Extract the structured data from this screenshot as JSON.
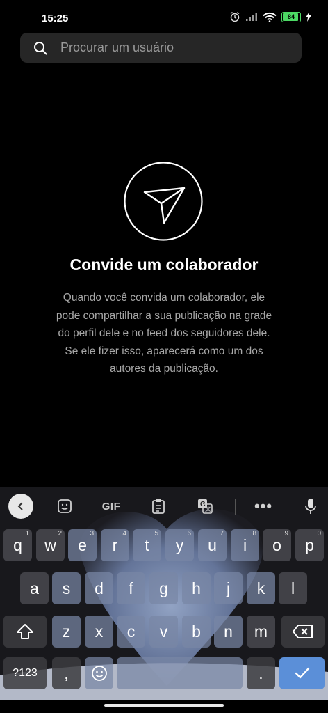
{
  "status_bar": {
    "time": "15:25",
    "battery_level": "84",
    "icons": [
      "alarm-icon",
      "signal-icon",
      "wifi-icon",
      "battery-icon",
      "charging-icon"
    ]
  },
  "search": {
    "placeholder": "Procurar um usuário",
    "icon": "search-icon"
  },
  "empty_state": {
    "icon": "send-icon",
    "title": "Convide um colaborador",
    "description": "Quando você convida um colaborador, ele pode compartilhar a sua publicação na grade do perfil dele e no feed dos seguidores dele. Se ele fizer isso, aparecerá como um dos autores da publicação."
  },
  "keyboard": {
    "toolbar": {
      "items": [
        "back-icon",
        "sticker-icon",
        "gif-button",
        "clipboard-icon",
        "translate-icon",
        "more-icon",
        "mic-icon"
      ],
      "gif_label": "GIF",
      "more_label": "•••"
    },
    "row1": [
      {
        "key": "q",
        "hint": "1"
      },
      {
        "key": "w",
        "hint": "2"
      },
      {
        "key": "e",
        "hint": "3"
      },
      {
        "key": "r",
        "hint": "4"
      },
      {
        "key": "t",
        "hint": "5"
      },
      {
        "key": "y",
        "hint": "6"
      },
      {
        "key": "u",
        "hint": "7"
      },
      {
        "key": "i",
        "hint": "8"
      },
      {
        "key": "o",
        "hint": "9"
      },
      {
        "key": "p",
        "hint": "0"
      }
    ],
    "row2": [
      "a",
      "s",
      "d",
      "f",
      "g",
      "h",
      "j",
      "k",
      "l"
    ],
    "row3": [
      "z",
      "x",
      "c",
      "v",
      "b",
      "n",
      "m"
    ],
    "row4": {
      "symbols_label": "?123",
      "comma": ",",
      "period": "."
    },
    "accent_color": "#5b8fd8"
  }
}
